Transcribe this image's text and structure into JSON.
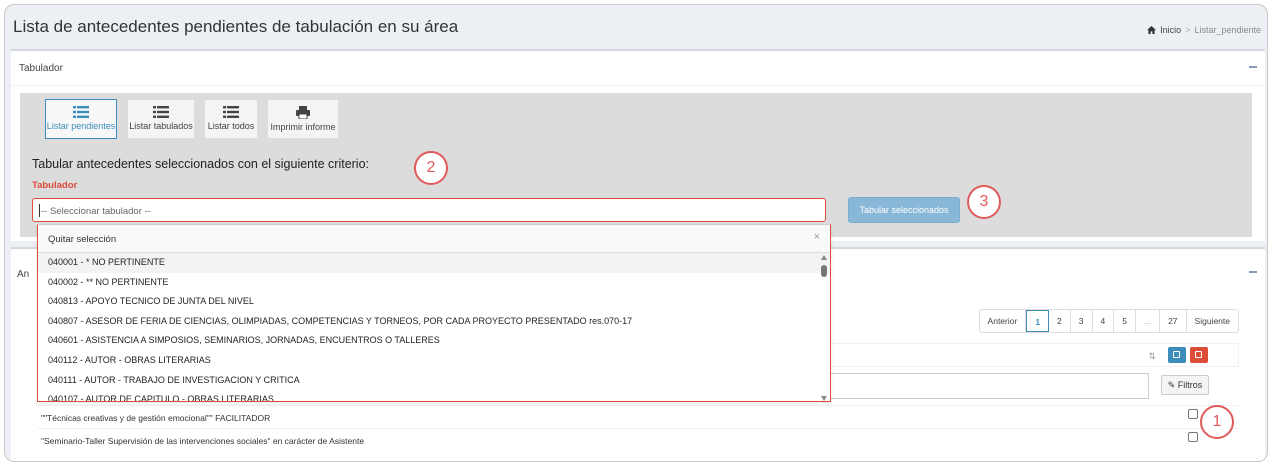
{
  "page": {
    "title": "Lista de antecedentes pendientes de tabulación en su área",
    "breadcrumb": {
      "home": "Inicio",
      "current": "Listar_pendiente"
    }
  },
  "tabulador_box": {
    "title": "Tabulador",
    "toolbar": [
      {
        "label": "Listar pendientes",
        "icon": "list-icon",
        "active": true
      },
      {
        "label": "Listar tabulados",
        "icon": "list-icon",
        "active": false
      },
      {
        "label": "Listar todos",
        "icon": "list-icon",
        "active": false
      },
      {
        "label": "Imprimir informe",
        "icon": "print-icon",
        "active": false
      }
    ],
    "criterio_text": "Tabular antecedentes seleccionados con el siguiente criterio:",
    "field_label": "Tabulador",
    "select_placeholder": "-- Seleccionar tabulador --",
    "submit_label": "Tabular seleccionados"
  },
  "dropdown": {
    "clear_label": "Quitar selección",
    "close_symbol": "×",
    "options": [
      "040001 - * NO PERTINENTE",
      "040002 - ** NO PERTINENTE",
      "040813 - APOYO TECNICO DE JUNTA DEL NIVEL",
      "040807 - ASESOR DE FERIA DE CIENCIAS, OLIMPIADAS, COMPETENCIAS Y TORNEOS, POR CADA PROYECTO PRESENTADO res.070-17",
      "040601 - ASISTENCIA A SIMPOSIOS, SEMINARIOS, JORNADAS, ENCUENTROS O TALLERES",
      "040112 - AUTOR - OBRAS LITERARIAS",
      "040111 - AUTOR - TRABAJO DE INVESTIGACION Y CRITICA",
      "040107 - AUTOR DE CAPITULO - OBRAS LITERARIAS"
    ]
  },
  "antecedentes_box": {
    "title_fragment": "An",
    "pagination": [
      "Anterior",
      "1",
      "2",
      "3",
      "4",
      "5",
      "...",
      "27",
      "Siguiente"
    ],
    "filtros_label": "Filtros",
    "rows": [
      "\"\"Técnicas creativas y de gestión emocional\"\" FACILITADOR",
      "\"Seminario-Taller Supervisión de las intervenciones sociales\" en carácter de Asistente"
    ]
  },
  "markers": [
    "1",
    "2",
    "3"
  ],
  "colors": {
    "primary": "#3c8dbc",
    "danger": "#dd4b39",
    "marker": "#e05a5a",
    "button_disabled": "#88b7d8"
  }
}
